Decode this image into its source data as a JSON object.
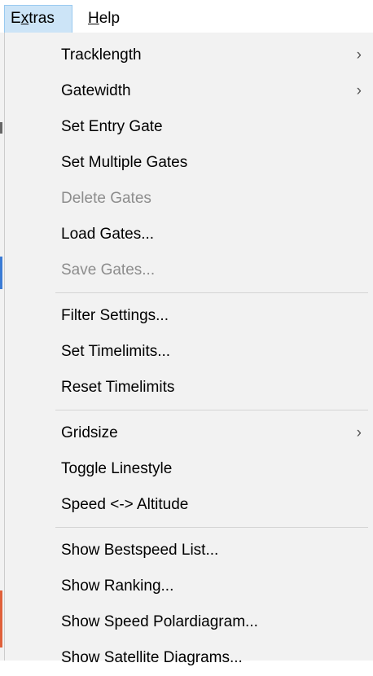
{
  "menubar": {
    "items": [
      {
        "label": "Extras",
        "accel": "x",
        "active": true
      },
      {
        "label": "Help",
        "accel": "H",
        "active": false
      }
    ]
  },
  "menu": {
    "groups": [
      [
        {
          "label": "Tracklength",
          "submenu": true,
          "enabled": true
        },
        {
          "label": "Gatewidth",
          "submenu": true,
          "enabled": true
        },
        {
          "label": "Set Entry Gate",
          "submenu": false,
          "enabled": true
        },
        {
          "label": "Set Multiple Gates",
          "submenu": false,
          "enabled": true
        },
        {
          "label": "Delete Gates",
          "submenu": false,
          "enabled": false
        },
        {
          "label": "Load Gates...",
          "submenu": false,
          "enabled": true
        },
        {
          "label": "Save Gates...",
          "submenu": false,
          "enabled": false
        }
      ],
      [
        {
          "label": "Filter Settings...",
          "submenu": false,
          "enabled": true
        },
        {
          "label": "Set Timelimits...",
          "submenu": false,
          "enabled": true
        },
        {
          "label": "Reset Timelimits",
          "submenu": false,
          "enabled": true
        }
      ],
      [
        {
          "label": "Gridsize",
          "submenu": true,
          "enabled": true
        },
        {
          "label": "Toggle Linestyle",
          "submenu": false,
          "enabled": true
        },
        {
          "label": "Speed <-> Altitude",
          "submenu": false,
          "enabled": true
        }
      ],
      [
        {
          "label": "Show Bestspeed List...",
          "submenu": false,
          "enabled": true
        },
        {
          "label": "Show Ranking...",
          "submenu": false,
          "enabled": true
        },
        {
          "label": "Show Speed Polardiagram...",
          "submenu": false,
          "enabled": true
        },
        {
          "label": "Show Satellite Diagrams...",
          "submenu": false,
          "enabled": true
        }
      ]
    ],
    "submenu_arrow_glyph": "›"
  },
  "colors": {
    "menubar_active_bg": "#cce4f7",
    "menubar_active_border": "#99c9ef",
    "menu_bg": "#f2f2f2",
    "disabled_text": "#8d8d8d",
    "separator": "#d4d4d4"
  }
}
